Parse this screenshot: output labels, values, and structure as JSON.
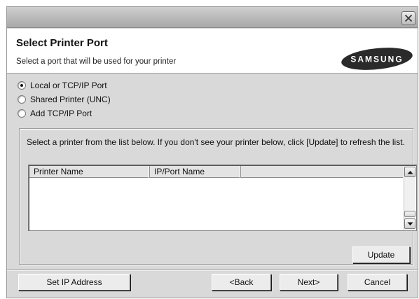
{
  "header": {
    "title": "Select Printer Port",
    "subtitle": "Select a port that will be used for your printer",
    "logo_text": "SAMSUNG"
  },
  "port_options": [
    {
      "label": "Local or TCP/IP Port",
      "checked": true
    },
    {
      "label": "Shared Printer (UNC)",
      "checked": false
    },
    {
      "label": "Add TCP/IP Port",
      "checked": false
    }
  ],
  "printer_list": {
    "instruction": "Select a printer from the list below. If you don't see your printer below, click [Update] to refresh the list.",
    "columns": [
      "Printer Name",
      "IP/Port Name",
      ""
    ],
    "rows": []
  },
  "buttons": {
    "update": "Update",
    "set_ip": "Set IP Address",
    "back": "<Back",
    "next": "Next>",
    "cancel": "Cancel"
  },
  "icons": {
    "close": "close-icon",
    "scroll_up": "arrow-up-icon",
    "scroll_down": "arrow-down-icon"
  },
  "colors": {
    "dialog_bg": "#d9d9d9",
    "header_bg": "#ffffff",
    "logo_fill": "#2a2a2a"
  }
}
